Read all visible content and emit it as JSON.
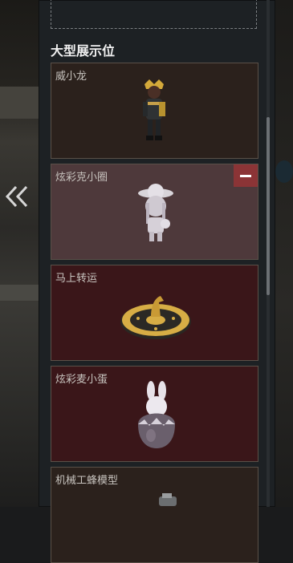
{
  "back_icon": "double-chevron-left-icon",
  "section": {
    "title": "大型展示位"
  },
  "colors": {
    "card_dark_brown": "#2b211c",
    "card_dusty_pink": "#4e393b",
    "card_maroon": "#3a1619",
    "remove_button": "#8b3436"
  },
  "cards": [
    {
      "label": "威小龙",
      "icon": "figure-hero-icon"
    },
    {
      "label": "炫彩克小圈",
      "icon": "figure-girl-icon",
      "action": "remove"
    },
    {
      "label": "马上转运",
      "icon": "horse-wheel-icon"
    },
    {
      "label": "炫彩麦小蛋",
      "icon": "egg-bunny-icon"
    },
    {
      "label": "机械工蜂模型",
      "icon": "mech-bee-icon"
    }
  ]
}
